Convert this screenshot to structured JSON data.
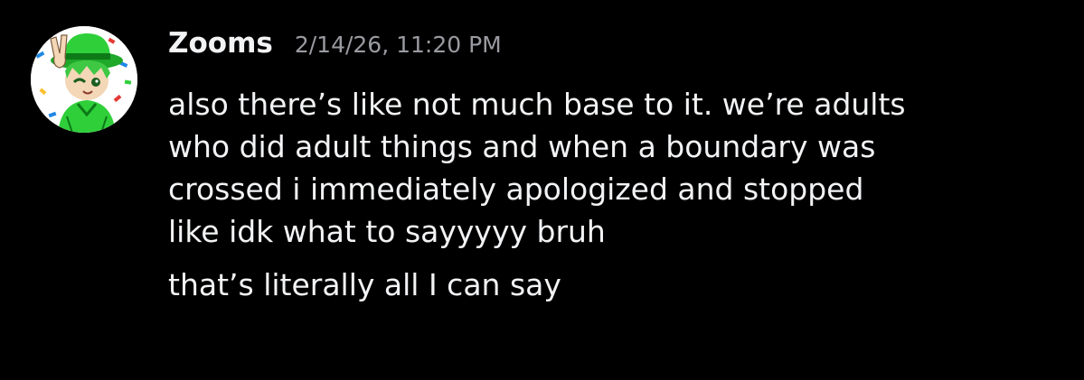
{
  "message": {
    "author": "Zooms",
    "timestamp": "2/14/26, 11:20 PM",
    "avatar": {
      "icon": "user-avatar-icon",
      "colors": [
        "#2fcf3a",
        "#1e88e5",
        "#ffffff",
        "#e53935"
      ]
    },
    "lines": [
      "also there’s like not much base to it. we’re adults",
      "who did adult things and when a boundary was",
      "crossed i immediately apologized and stopped",
      "like idk what to sayyyyy bruh"
    ],
    "followup": "that’s literally all I can say"
  },
  "colors": {
    "background": "#000000",
    "text": "#f2f3f5",
    "muted": "#9a9ba1"
  }
}
